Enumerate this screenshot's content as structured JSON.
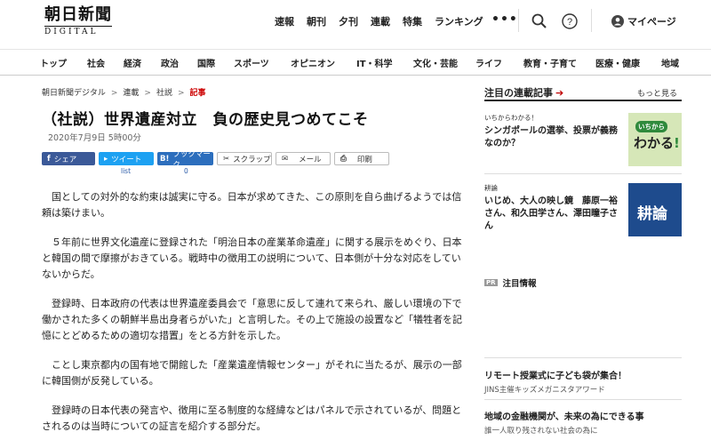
{
  "header": {
    "logo_main": "朝日新聞",
    "logo_sub": "DIGITAL",
    "top_links": [
      "速報",
      "朝刊",
      "夕刊",
      "連載",
      "特集",
      "ランキング"
    ],
    "more_dots": "•••",
    "mypage": "マイページ"
  },
  "nav": [
    "トップ",
    "社会",
    "経済",
    "政治",
    "国際",
    "スポーツ",
    "オピニオン",
    "IT・科学",
    "文化・芸能",
    "ライフ",
    "教育・子育て",
    "医療・健康",
    "地域"
  ],
  "breadcrumb": [
    "朝日新聞デジタル",
    "連載",
    "社説",
    "記事"
  ],
  "article": {
    "title": "（社説）世界遺産対立　負の歴史見つめてこそ",
    "date": "2020年7月9日 5時00分",
    "share": {
      "facebook": "シェア",
      "twitter": "ツイート",
      "twitter_sub": "list",
      "hatena": "ブックマーク",
      "hatena_sub": "0",
      "clip": "スクラップ",
      "mail": "メール",
      "print": "印刷"
    },
    "paragraphs": [
      "国としての対外的な約束は誠実に守る。日本が求めてきた、この原則を自ら曲げるようでは信頼は築けまい。",
      "５年前に世界文化遺産に登録された「明治日本の産業革命遺産」に関する展示をめぐり、日本と韓国の間で摩擦がおきている。戦時中の徴用工の説明について、日本側が十分な対応をしていないからだ。",
      "登録時、日本政府の代表は世界遺産委員会で「意思に反して連れて来られ、厳しい環境の下で働かされた多くの朝鮮半島出身者らがいた」と言明した。その上で施設の設置など「犠牲者を記憶にとどめるための適切な措置」をとる方針を示した。",
      "ことし東京都内の国有地で開館した「産業遺産情報センター」がそれに当たるが、展示の一部に韓国側が反発している。",
      "登録時の日本代表の発言や、徴用に至る制度的な経緯などはパネルで示されているが、問題とされるのは当時についての証言を紹介する部分だ。"
    ]
  },
  "sidebar": {
    "heading": "注目の連載記事",
    "more": "もっと見る",
    "items": [
      {
        "category": "いちからわかる！",
        "text": "シンガポールの選挙、投票が義務なのか？",
        "thumb_text1": "いちから",
        "thumb_text2": "わかる"
      },
      {
        "category": "耕論",
        "text": "いじめ、大人の映し鏡　藤原一裕さん、和久田学さん、澤田瞳子さん",
        "thumb_text1": "耕論"
      }
    ],
    "pr_tag": "PR",
    "pr_label": "注目情報",
    "ads": [
      {
        "title": "リモート授業式に子ども袋が集合！",
        "sub": "JINS主催キッズメガニスタアワード"
      },
      {
        "title": "地域の金融機関が、未来の為にできる事",
        "sub": "誰一人取り残されない社会の為に"
      }
    ]
  },
  "colors": {
    "facebook": "#3b5998",
    "twitter": "#1da1f2",
    "hatena": "#2c6ebd",
    "accent_red": "#c00000",
    "thumb_green": "#d6e7b8",
    "thumb_blue": "#1e4b8d"
  }
}
